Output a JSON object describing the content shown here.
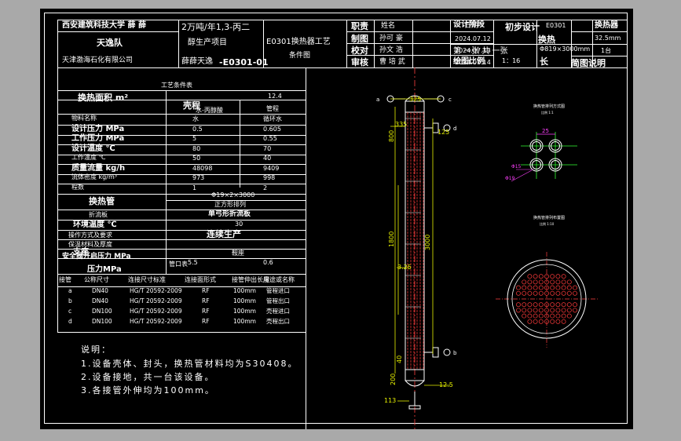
{
  "title_block": {
    "school": "西安建筑科技大学 薛 薛",
    "team": "天逸队",
    "company": "天津渤海石化有限公司",
    "project_line1": "2万吨/年1,3-丙二",
    "project_line2": "醇生产项目",
    "author": "薛薛天逸",
    "drawing_code": "-E0301-01",
    "drawing_title_1": "E0301换热器工艺",
    "drawing_title_2": "条件图",
    "role_header": "职责",
    "name_header": "姓名",
    "date_header": "日期",
    "roles": [
      {
        "role": "制图",
        "name": "孙可 豪",
        "date": "2024.07.12"
      },
      {
        "role": "校对",
        "name": "孙文 浩",
        "date": "2024.07.13"
      },
      {
        "role": "审核",
        "name": "曹 培 武",
        "date": "2024.07.14"
      }
    ],
    "stage_label": "设计阶段",
    "stage_value": "初步设计",
    "sheet_info": "第 一张  共 一张",
    "scale_label": "绘图比例",
    "scale_value": "1：16",
    "equipment_code": "E0301",
    "equipment_size": "Φ819×3000mm",
    "exchanger_type": "换热器",
    "area_value": "32.5mm",
    "quantity": "1台",
    "diagram_label": "简图说明",
    "flag_label": "换热",
    "flag2": "长"
  },
  "process_conditions": {
    "title": "工艺条件表",
    "area_label": "换热面积 m²",
    "area_value": "12.4",
    "col_shell": "壳程",
    "col_tube": "管程",
    "sub_shell": "水-丙醇酸",
    "rows": [
      {
        "label": "物料名称",
        "shell": "水",
        "tube": "循环水"
      },
      {
        "label": "设计压力 MPa",
        "shell": "0.5",
        "tube": "0.605"
      },
      {
        "label": "工作压力 MPa",
        "shell": "5",
        "tube": "0.55"
      },
      {
        "label": "设计温度 ℃",
        "shell": "80",
        "tube": "70"
      },
      {
        "label": "工作温度 ℃",
        "shell": "50",
        "tube": "40"
      },
      {
        "label": "质量流量 kg/h",
        "shell": "48098",
        "tube": "9409"
      },
      {
        "label": "流体密度 kg/m³",
        "shell": "973",
        "tube": "998"
      },
      {
        "label": "程数",
        "shell": "1",
        "tube": "2"
      }
    ],
    "tube_label": "换热管",
    "tube_value": "Φ19×2×3000",
    "tube_arrangement": "正方形排列",
    "baffle_label": "折流板",
    "baffle_value": "单弓形折流板",
    "ambient_label": "环境温度 ℃",
    "ambient_value": "30",
    "operation_label": "操作方式及要求",
    "operation_value": "连续生产",
    "insulation_label": "保温材料及厚度",
    "support_label": "支座",
    "support_value": "鞍座",
    "safety_label": "安全阀开启压力 MPa",
    "safety_shell": "5.5",
    "safety_tube": "0.6"
  },
  "nozzle_table": {
    "title": "管口表",
    "headers": [
      "接管",
      "公称尺寸",
      "连接尺寸标准",
      "连接面形式",
      "接管伸出长度",
      "用途或名称"
    ],
    "rows": [
      {
        "id": "a",
        "dn": "DN40",
        "std": "HG/T 20592-2009",
        "face": "RF",
        "len": "100mm",
        "use": "管程进口"
      },
      {
        "id": "b",
        "dn": "DN40",
        "std": "HG/T 20592-2009",
        "face": "RF",
        "len": "100mm",
        "use": "管程出口"
      },
      {
        "id": "c",
        "dn": "DN100",
        "std": "HG/T 20592-2009",
        "face": "RF",
        "len": "100mm",
        "use": "壳程进口"
      },
      {
        "id": "d",
        "dn": "DN100",
        "std": "HG/T 20592-2009",
        "face": "RF",
        "len": "100mm",
        "use": "壳程出口"
      }
    ]
  },
  "notes": {
    "title": "说明：",
    "lines": [
      "1.设备壳体、封头，换热管材料均为S30408。",
      "2.设备接地，共一台该设备。",
      "3.各接管外伸均为100mm。"
    ]
  },
  "elevation_dims": {
    "top_width": "325",
    "d1": "335",
    "d2": "800",
    "d3": "125",
    "d4": "1800",
    "d5": "3000",
    "d6": "3.25",
    "d7": "40",
    "d8": "200",
    "d9": "12.5",
    "d10": "113",
    "nozzle_labels": [
      "a",
      "c",
      "d",
      "b"
    ]
  },
  "section_views": {
    "arrangement_title": "换热管排列方式图",
    "arrangement_scale": "比例 1:1",
    "pitch": "25",
    "d_tube1": "Φ15",
    "d_tube2": "Φ19",
    "layout_title": "换热管排列布置图",
    "layout_scale": "比例 1:10"
  },
  "colors": {
    "background": "#a9a9a9",
    "sheet": "#000000",
    "line": "#ffffff",
    "tube": "#ff3b3b",
    "centerline": "#ff4040",
    "dimension": "#e6f000",
    "green": "#33ff33",
    "magenta": "#ff40ff"
  }
}
